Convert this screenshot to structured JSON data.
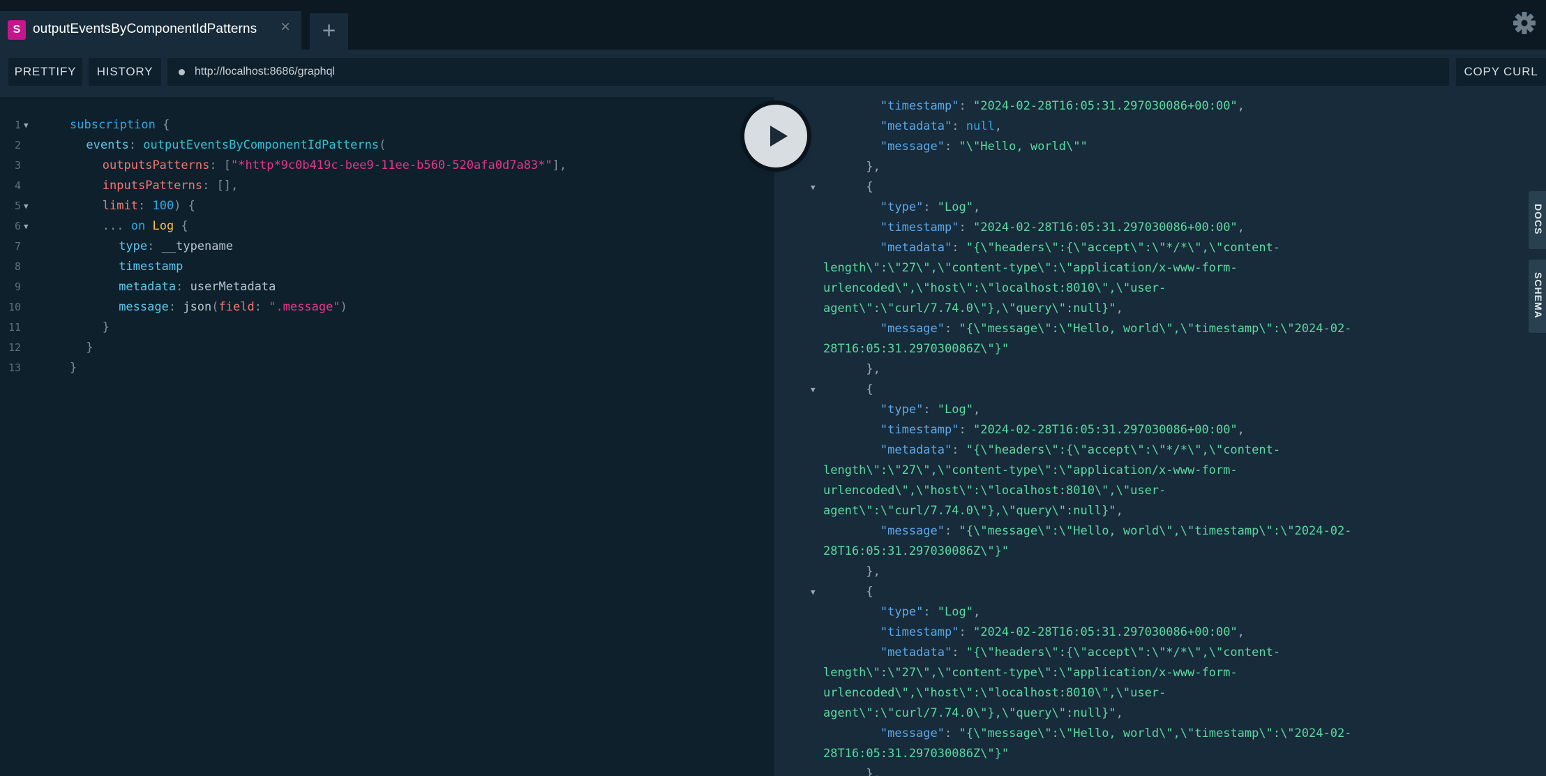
{
  "tab": {
    "badge": "S",
    "title": "outputEventsByComponentIdPatterns",
    "close": "×",
    "add": "+"
  },
  "toolbar": {
    "prettify": "PRETTIFY",
    "history": "HISTORY",
    "url": "http://localhost:8686/graphql",
    "copy_curl": "COPY CURL"
  },
  "side_tabs": {
    "docs": "DOCS",
    "schema": "SCHEMA"
  },
  "query_lines": [
    {
      "n": "1",
      "fold": true,
      "indent": 0,
      "tokens": [
        [
          "kw",
          "subscription"
        ],
        [
          "punc",
          " {"
        ]
      ]
    },
    {
      "n": "2",
      "fold": false,
      "indent": 1,
      "tokens": [
        [
          "field",
          "events"
        ],
        [
          "punc",
          ": "
        ],
        [
          "def",
          "outputEventsByComponentIdPatterns"
        ],
        [
          "punc",
          "("
        ]
      ]
    },
    {
      "n": "3",
      "fold": false,
      "indent": 2,
      "tokens": [
        [
          "arg",
          "outputsPatterns"
        ],
        [
          "punc",
          ": ["
        ],
        [
          "str",
          "\"*http*9c0b419c-bee9-11ee-b560-520afa0d7a83*\""
        ],
        [
          "punc",
          "],"
        ]
      ]
    },
    {
      "n": "4",
      "fold": false,
      "indent": 2,
      "tokens": [
        [
          "arg",
          "inputsPatterns"
        ],
        [
          "punc",
          ": [],"
        ]
      ]
    },
    {
      "n": "5",
      "fold": true,
      "indent": 2,
      "tokens": [
        [
          "arg",
          "limit"
        ],
        [
          "punc",
          ": "
        ],
        [
          "num",
          "100"
        ],
        [
          "punc",
          ") {"
        ]
      ]
    },
    {
      "n": "6",
      "fold": true,
      "indent": 2,
      "tokens": [
        [
          "punc",
          "... "
        ],
        [
          "kw",
          "on"
        ],
        [
          "plain",
          " "
        ],
        [
          "type",
          "Log"
        ],
        [
          "punc",
          " {"
        ]
      ]
    },
    {
      "n": "7",
      "fold": false,
      "indent": 3,
      "tokens": [
        [
          "field",
          "type"
        ],
        [
          "punc",
          ": "
        ],
        [
          "plain",
          "__typename"
        ]
      ]
    },
    {
      "n": "8",
      "fold": false,
      "indent": 3,
      "tokens": [
        [
          "field",
          "timestamp"
        ]
      ]
    },
    {
      "n": "9",
      "fold": false,
      "indent": 3,
      "tokens": [
        [
          "field",
          "metadata"
        ],
        [
          "punc",
          ": "
        ],
        [
          "plain",
          "userMetadata"
        ]
      ]
    },
    {
      "n": "10",
      "fold": false,
      "indent": 3,
      "tokens": [
        [
          "field",
          "message"
        ],
        [
          "punc",
          ": "
        ],
        [
          "plain",
          "json"
        ],
        [
          "punc",
          "("
        ],
        [
          "arg",
          "field"
        ],
        [
          "punc",
          ": "
        ],
        [
          "str",
          "\".message\""
        ],
        [
          "punc",
          ")"
        ]
      ]
    },
    {
      "n": "11",
      "fold": false,
      "indent": 2,
      "tokens": [
        [
          "punc",
          "}"
        ]
      ]
    },
    {
      "n": "12",
      "fold": false,
      "indent": 1,
      "tokens": [
        [
          "punc",
          "}"
        ]
      ]
    },
    {
      "n": "13",
      "fold": false,
      "indent": 0,
      "tokens": [
        [
          "punc",
          "}"
        ]
      ]
    }
  ],
  "result_lines": [
    {
      "fold": false,
      "tokens": [
        [
          "punc",
          "        "
        ],
        [
          "prop",
          "\"timestamp\""
        ],
        [
          "punc",
          ": "
        ],
        [
          "str",
          "\"2024-02-28T16:05:31.297030086+00:00\""
        ],
        [
          "punc",
          ","
        ]
      ]
    },
    {
      "fold": false,
      "tokens": [
        [
          "punc",
          "        "
        ],
        [
          "prop",
          "\"metadata\""
        ],
        [
          "punc",
          ": "
        ],
        [
          "null",
          "null"
        ],
        [
          "punc",
          ","
        ]
      ]
    },
    {
      "fold": false,
      "tokens": [
        [
          "punc",
          "        "
        ],
        [
          "prop",
          "\"message\""
        ],
        [
          "punc",
          ": "
        ],
        [
          "str",
          "\"\\\"Hello, world\\\"\""
        ]
      ]
    },
    {
      "fold": false,
      "tokens": [
        [
          "punc",
          "      },"
        ]
      ]
    },
    {
      "fold": true,
      "tokens": [
        [
          "punc",
          "      {"
        ]
      ]
    },
    {
      "fold": false,
      "tokens": [
        [
          "punc",
          "        "
        ],
        [
          "prop",
          "\"type\""
        ],
        [
          "punc",
          ": "
        ],
        [
          "str",
          "\"Log\""
        ],
        [
          "punc",
          ","
        ]
      ]
    },
    {
      "fold": false,
      "tokens": [
        [
          "punc",
          "        "
        ],
        [
          "prop",
          "\"timestamp\""
        ],
        [
          "punc",
          ": "
        ],
        [
          "str",
          "\"2024-02-28T16:05:31.297030086+00:00\""
        ],
        [
          "punc",
          ","
        ]
      ]
    },
    {
      "fold": false,
      "tokens": [
        [
          "punc",
          "        "
        ],
        [
          "prop",
          "\"metadata\""
        ],
        [
          "punc",
          ": "
        ],
        [
          "str",
          "\"{\\\"headers\\\":{\\\"accept\\\":\\\"*/*\\\",\\\"content-"
        ]
      ]
    },
    {
      "fold": false,
      "tokens": [
        [
          "str",
          "length\\\":\\\"27\\\",\\\"content-type\\\":\\\"application/x-www-form-"
        ]
      ]
    },
    {
      "fold": false,
      "tokens": [
        [
          "str",
          "urlencoded\\\",\\\"host\\\":\\\"localhost:8010\\\",\\\"user-"
        ]
      ]
    },
    {
      "fold": false,
      "tokens": [
        [
          "str",
          "agent\\\":\\\"curl/7.74.0\\\"},\\\"query\\\":null}\""
        ],
        [
          "punc",
          ","
        ]
      ]
    },
    {
      "fold": false,
      "tokens": [
        [
          "punc",
          "        "
        ],
        [
          "prop",
          "\"message\""
        ],
        [
          "punc",
          ": "
        ],
        [
          "str",
          "\"{\\\"message\\\":\\\"Hello, world\\\",\\\"timestamp\\\":\\\"2024-02-"
        ]
      ]
    },
    {
      "fold": false,
      "tokens": [
        [
          "str",
          "28T16:05:31.297030086Z\\\"}\""
        ]
      ]
    },
    {
      "fold": false,
      "tokens": [
        [
          "punc",
          "      },"
        ]
      ]
    },
    {
      "fold": true,
      "tokens": [
        [
          "punc",
          "      {"
        ]
      ]
    },
    {
      "fold": false,
      "tokens": [
        [
          "punc",
          "        "
        ],
        [
          "prop",
          "\"type\""
        ],
        [
          "punc",
          ": "
        ],
        [
          "str",
          "\"Log\""
        ],
        [
          "punc",
          ","
        ]
      ]
    },
    {
      "fold": false,
      "tokens": [
        [
          "punc",
          "        "
        ],
        [
          "prop",
          "\"timestamp\""
        ],
        [
          "punc",
          ": "
        ],
        [
          "str",
          "\"2024-02-28T16:05:31.297030086+00:00\""
        ],
        [
          "punc",
          ","
        ]
      ]
    },
    {
      "fold": false,
      "tokens": [
        [
          "punc",
          "        "
        ],
        [
          "prop",
          "\"metadata\""
        ],
        [
          "punc",
          ": "
        ],
        [
          "str",
          "\"{\\\"headers\\\":{\\\"accept\\\":\\\"*/*\\\",\\\"content-"
        ]
      ]
    },
    {
      "fold": false,
      "tokens": [
        [
          "str",
          "length\\\":\\\"27\\\",\\\"content-type\\\":\\\"application/x-www-form-"
        ]
      ]
    },
    {
      "fold": false,
      "tokens": [
        [
          "str",
          "urlencoded\\\",\\\"host\\\":\\\"localhost:8010\\\",\\\"user-"
        ]
      ]
    },
    {
      "fold": false,
      "tokens": [
        [
          "str",
          "agent\\\":\\\"curl/7.74.0\\\"},\\\"query\\\":null}\""
        ],
        [
          "punc",
          ","
        ]
      ]
    },
    {
      "fold": false,
      "tokens": [
        [
          "punc",
          "        "
        ],
        [
          "prop",
          "\"message\""
        ],
        [
          "punc",
          ": "
        ],
        [
          "str",
          "\"{\\\"message\\\":\\\"Hello, world\\\",\\\"timestamp\\\":\\\"2024-02-"
        ]
      ]
    },
    {
      "fold": false,
      "tokens": [
        [
          "str",
          "28T16:05:31.297030086Z\\\"}\""
        ]
      ]
    },
    {
      "fold": false,
      "tokens": [
        [
          "punc",
          "      },"
        ]
      ]
    },
    {
      "fold": true,
      "tokens": [
        [
          "punc",
          "      {"
        ]
      ]
    },
    {
      "fold": false,
      "tokens": [
        [
          "punc",
          "        "
        ],
        [
          "prop",
          "\"type\""
        ],
        [
          "punc",
          ": "
        ],
        [
          "str",
          "\"Log\""
        ],
        [
          "punc",
          ","
        ]
      ]
    },
    {
      "fold": false,
      "tokens": [
        [
          "punc",
          "        "
        ],
        [
          "prop",
          "\"timestamp\""
        ],
        [
          "punc",
          ": "
        ],
        [
          "str",
          "\"2024-02-28T16:05:31.297030086+00:00\""
        ],
        [
          "punc",
          ","
        ]
      ]
    },
    {
      "fold": false,
      "tokens": [
        [
          "punc",
          "        "
        ],
        [
          "prop",
          "\"metadata\""
        ],
        [
          "punc",
          ": "
        ],
        [
          "str",
          "\"{\\\"headers\\\":{\\\"accept\\\":\\\"*/*\\\",\\\"content-"
        ]
      ]
    },
    {
      "fold": false,
      "tokens": [
        [
          "str",
          "length\\\":\\\"27\\\",\\\"content-type\\\":\\\"application/x-www-form-"
        ]
      ]
    },
    {
      "fold": false,
      "tokens": [
        [
          "str",
          "urlencoded\\\",\\\"host\\\":\\\"localhost:8010\\\",\\\"user-"
        ]
      ]
    },
    {
      "fold": false,
      "tokens": [
        [
          "str",
          "agent\\\":\\\"curl/7.74.0\\\"},\\\"query\\\":null}\""
        ],
        [
          "punc",
          ","
        ]
      ]
    },
    {
      "fold": false,
      "tokens": [
        [
          "punc",
          "        "
        ],
        [
          "prop",
          "\"message\""
        ],
        [
          "punc",
          ": "
        ],
        [
          "str",
          "\"{\\\"message\\\":\\\"Hello, world\\\",\\\"timestamp\\\":\\\"2024-02-"
        ]
      ]
    },
    {
      "fold": false,
      "tokens": [
        [
          "str",
          "28T16:05:31.297030086Z\\\"}\""
        ]
      ]
    },
    {
      "fold": false,
      "tokens": [
        [
          "punc",
          "      },"
        ]
      ]
    }
  ]
}
